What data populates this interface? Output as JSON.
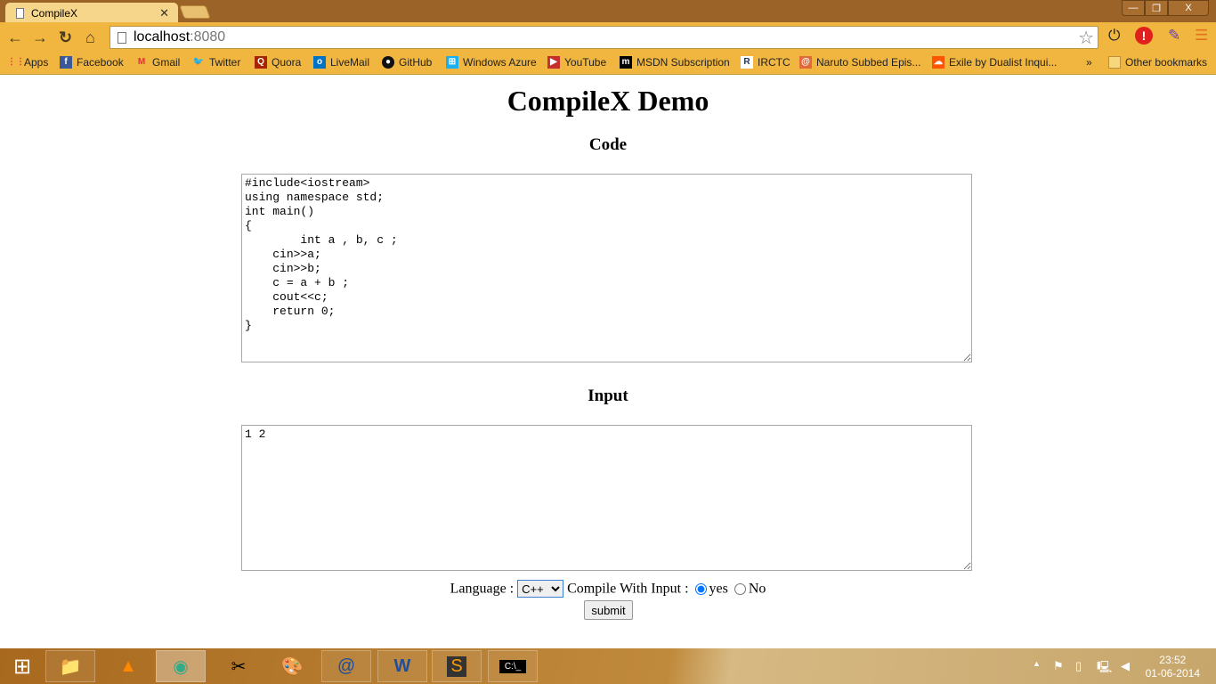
{
  "browser": {
    "tab_title": "CompileX",
    "url_host": "localhost",
    "url_port": ":8080",
    "bookmarks": [
      {
        "label": "Apps",
        "icon": "apps-grid-icon"
      },
      {
        "label": "Facebook",
        "icon": "facebook-icon"
      },
      {
        "label": "Gmail",
        "icon": "gmail-icon"
      },
      {
        "label": "Twitter",
        "icon": "twitter-icon"
      },
      {
        "label": "Quora",
        "icon": "quora-icon"
      },
      {
        "label": "LiveMail",
        "icon": "outlook-icon"
      },
      {
        "label": "GitHub",
        "icon": "github-icon"
      },
      {
        "label": "Windows Azure",
        "icon": "windows-icon"
      },
      {
        "label": "YouTube",
        "icon": "youtube-icon"
      },
      {
        "label": "MSDN Subscription",
        "icon": "msdn-icon"
      },
      {
        "label": "IRCTC",
        "icon": "irctc-icon"
      },
      {
        "label": "Naruto Subbed Epis...",
        "icon": "naruto-icon"
      },
      {
        "label": "Exile by Dualist Inqui...",
        "icon": "soundcloud-icon"
      }
    ],
    "overflow": "»",
    "other_bookmarks": "Other bookmarks"
  },
  "page": {
    "title": "CompileX Demo",
    "code_heading": "Code",
    "code": "#include<iostream>\nusing namespace std;\nint main()\n{\n\tint a , b, c ;\n    cin>>a;\n    cin>>b;\n    c = a + b ;\n    cout<<c;\n    return 0;\n}",
    "input_heading": "Input",
    "input": "1 2",
    "language_label": "Language :",
    "language_selected": "C++",
    "compile_with_input_label": "Compile With Input :",
    "radio_yes": "yes",
    "radio_no": "No",
    "radio_selected": "yes",
    "submit_label": "submit"
  },
  "taskbar": {
    "time": "23:52",
    "date": "01-06-2014"
  }
}
